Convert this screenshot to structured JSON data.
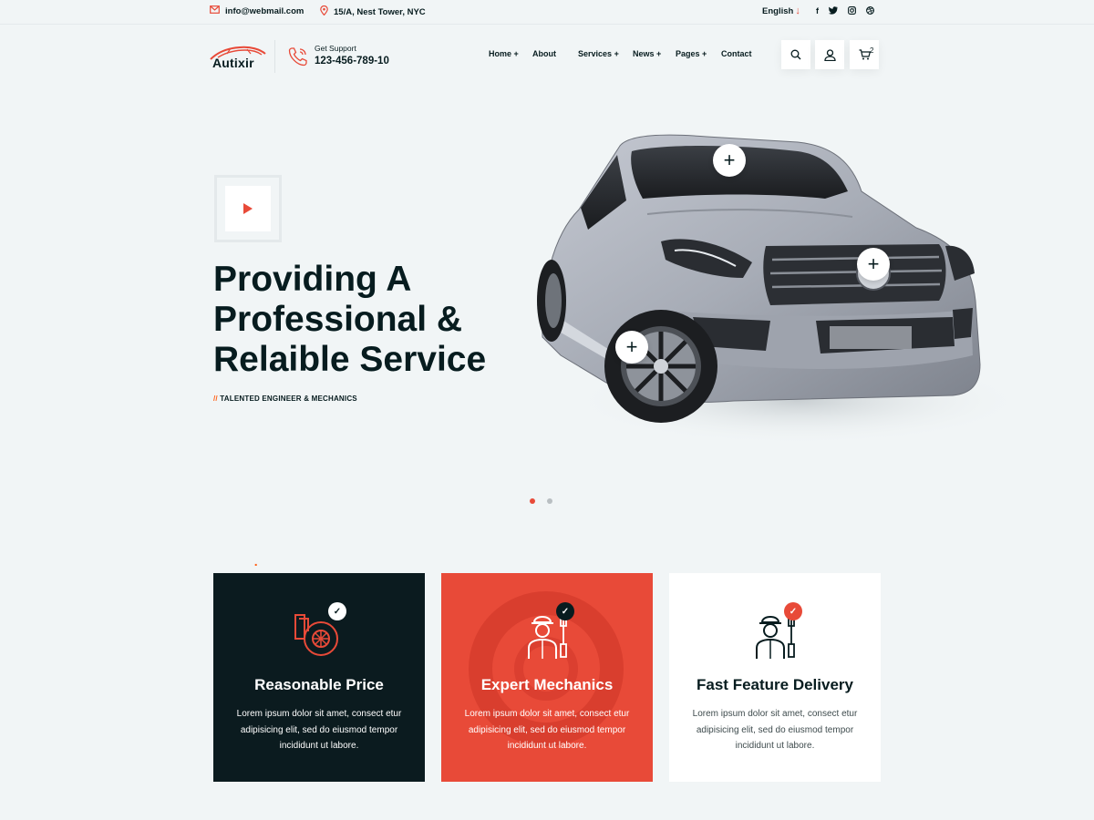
{
  "topbar": {
    "email": "info@webmail.com",
    "address": "15/A, Nest Tower, NYC",
    "language": "English",
    "social": [
      "facebook-icon",
      "twitter-icon",
      "instagram-icon",
      "dribbble-icon"
    ]
  },
  "header": {
    "logo_text": "Autixir",
    "logo_dot": ".",
    "support_label": "Get Support",
    "support_phone": "123-456-789-10",
    "nav": [
      {
        "label": "Home",
        "plus": "+"
      },
      {
        "label": "About",
        "plus": ""
      },
      {
        "label": "Services",
        "plus": "+"
      },
      {
        "label": "News",
        "plus": "+"
      },
      {
        "label": "Pages",
        "plus": "+"
      },
      {
        "label": "Contact",
        "plus": ""
      }
    ],
    "cart_count": "2"
  },
  "hero": {
    "title_line1": "Providing A",
    "title_line2": "Professional &",
    "title_line3": "Relaible Service",
    "sub_prefix": "//",
    "subtitle": "TALENTED ENGINEER & MECHANICS",
    "hotspot_symbol": "+",
    "active_slide": 1,
    "slide_count": 2
  },
  "features": [
    {
      "title": "Reasonable Price",
      "text": "Lorem ipsum dolor sit amet, consect etur adipisicing elit, sed do eiusmod tempor incididunt ut labore.",
      "icon": "turbo-icon"
    },
    {
      "title": "Expert Mechanics",
      "text": "Lorem ipsum dolor sit amet, consect etur adipisicing elit, sed do eiusmod tempor incididunt ut labore.",
      "icon": "mechanic-icon"
    },
    {
      "title": "Fast Feature Delivery",
      "text": "Lorem ipsum dolor sit amet, consect etur adipisicing elit, sed do eiusmod tempor incididunt ut labore.",
      "icon": "mechanic-icon"
    }
  ],
  "colors": {
    "accent": "#ff5e14",
    "dark": "#071c1f",
    "card_red": "#e84a38",
    "bg": "#f1f5f6"
  }
}
